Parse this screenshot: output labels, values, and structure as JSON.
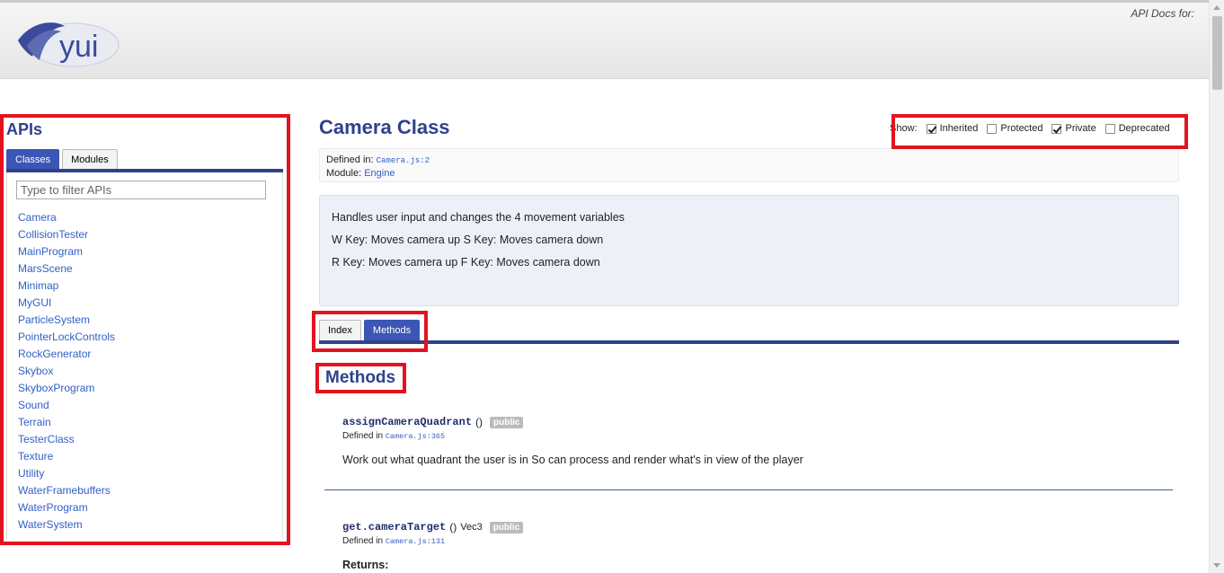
{
  "header": {
    "api_docs_label": "API Docs for:",
    "logo_text": "yui"
  },
  "sidebar": {
    "title": "APIs",
    "tabs": [
      {
        "label": "Classes",
        "active": true
      },
      {
        "label": "Modules",
        "active": false
      }
    ],
    "filter_placeholder": "Type to filter APIs",
    "classes": [
      "Camera",
      "CollisionTester",
      "MainProgram",
      "MarsScene",
      "Minimap",
      "MyGUI",
      "ParticleSystem",
      "PointerLockControls",
      "RockGenerator",
      "Skybox",
      "SkyboxProgram",
      "Sound",
      "Terrain",
      "TesterClass",
      "Texture",
      "Utility",
      "WaterFramebuffers",
      "WaterProgram",
      "WaterSystem"
    ]
  },
  "main": {
    "title": "Camera Class",
    "show": {
      "label": "Show:",
      "options": [
        {
          "label": "Inherited",
          "checked": true
        },
        {
          "label": "Protected",
          "checked": false
        },
        {
          "label": "Private",
          "checked": true
        },
        {
          "label": "Deprecated",
          "checked": false
        }
      ]
    },
    "meta": {
      "defined_in_label": "Defined in:",
      "defined_in_file": "Camera.js:2",
      "module_label": "Module:",
      "module": "Engine"
    },
    "description": [
      "Handles user input and changes the 4 movement variables",
      "W Key: Moves camera up S Key: Moves camera down",
      "R Key: Moves camera up F Key: Moves camera down"
    ],
    "tabs": [
      {
        "label": "Index",
        "active": false
      },
      {
        "label": "Methods",
        "active": true
      }
    ],
    "methods_heading": "Methods",
    "methods": [
      {
        "name": "assignCameraQuadrant",
        "params": "()",
        "returns": "",
        "badge": "public",
        "defined_in_label": "Defined in",
        "file": "Camera.js:365",
        "description": "Work out what quadrant the user is in So can process and render what's in view of the player"
      },
      {
        "name": "get.cameraTarget",
        "params": "()",
        "returns": "Vec3",
        "badge": "public",
        "defined_in_label": "Defined in",
        "file": "Camera.js:131",
        "returns_label": "Returns:"
      }
    ]
  },
  "colors": {
    "highlight": "#e2131f",
    "title_blue": "#30418c",
    "link_blue": "#3160c4",
    "tab_active": "#3b56b5"
  }
}
